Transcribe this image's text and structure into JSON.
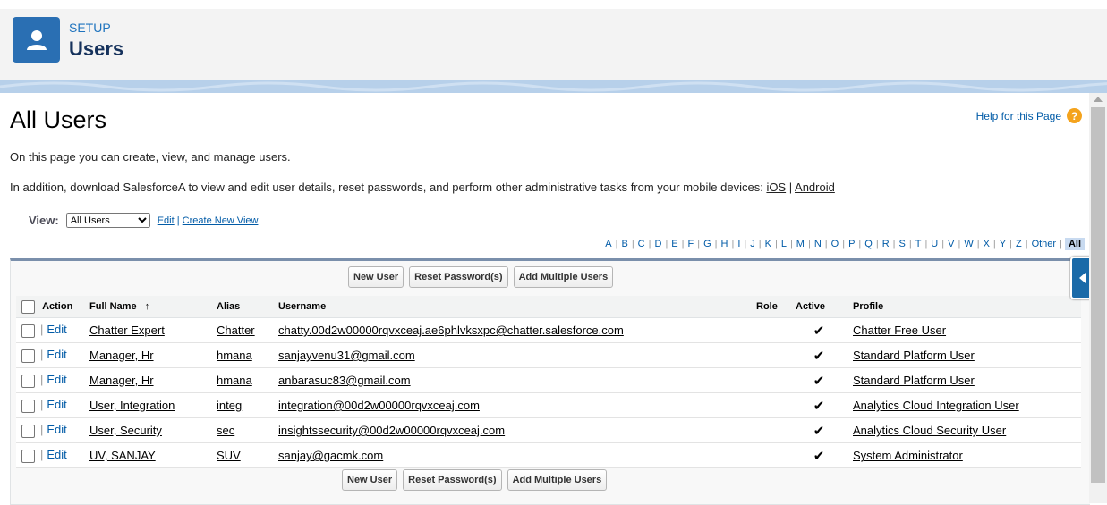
{
  "header": {
    "section": "SETUP",
    "title": "Users"
  },
  "page": {
    "title": "All Users",
    "help_link": "Help for this Page",
    "help_icon": "?",
    "description": "On this page you can create, view, and manage users.",
    "mobile_text": "In addition, download SalesforceA to view and edit user details, reset passwords, and perform other administrative tasks from your mobile devices:",
    "ios_link": "iOS",
    "link_separator": "|",
    "android_link": "Android"
  },
  "view": {
    "label": "View:",
    "selected": "All Users",
    "edit_link": "Edit",
    "separator": "|",
    "create_link": "Create New View"
  },
  "alphabet": [
    "A",
    "B",
    "C",
    "D",
    "E",
    "F",
    "G",
    "H",
    "I",
    "J",
    "K",
    "L",
    "M",
    "N",
    "O",
    "P",
    "Q",
    "R",
    "S",
    "T",
    "U",
    "V",
    "W",
    "X",
    "Y",
    "Z",
    "Other"
  ],
  "alphabet_all": "All",
  "buttons": {
    "new_user": "New User",
    "reset_password": "Reset Password(s)",
    "add_multiple": "Add Multiple Users"
  },
  "table": {
    "headers": {
      "action": "Action",
      "full_name": "Full Name",
      "sort_arrow": "↑",
      "alias": "Alias",
      "username": "Username",
      "role": "Role",
      "active": "Active",
      "profile": "Profile"
    },
    "edit_label": "Edit",
    "row_pipe": "|",
    "check_mark": "✔",
    "rows": [
      {
        "full_name": "Chatter Expert",
        "alias": "Chatter",
        "username": "chatty.00d2w00000rqvxceaj.ae6phlvksxpc@chatter.salesforce.com",
        "role": "",
        "active": true,
        "profile": "Chatter Free User"
      },
      {
        "full_name": "Manager, Hr",
        "alias": "hmana",
        "username": "sanjayvenu31@gmail.com",
        "role": "",
        "active": true,
        "profile": "Standard Platform User"
      },
      {
        "full_name": "Manager, Hr",
        "alias": "hmana",
        "username": "anbarasuc83@gmail.com",
        "role": "",
        "active": true,
        "profile": "Standard Platform User"
      },
      {
        "full_name": "User, Integration",
        "alias": "integ",
        "username": "integration@00d2w00000rqvxceaj.com",
        "role": "",
        "active": true,
        "profile": "Analytics Cloud Integration User"
      },
      {
        "full_name": "User, Security",
        "alias": "sec",
        "username": "insightssecurity@00d2w00000rqvxceaj.com",
        "role": "",
        "active": true,
        "profile": "Analytics Cloud Security User"
      },
      {
        "full_name": "UV, SANJAY",
        "alias": "SUV",
        "username": "sanjay@gacmk.com",
        "role": "",
        "active": true,
        "profile": "System Administrator"
      }
    ]
  },
  "colors": {
    "brand_blue": "#2a6fb3",
    "link_blue": "#015ba7",
    "header_bg": "#f3f3f3",
    "band": "#b7d0ea",
    "help_orange": "#f4a31d"
  }
}
